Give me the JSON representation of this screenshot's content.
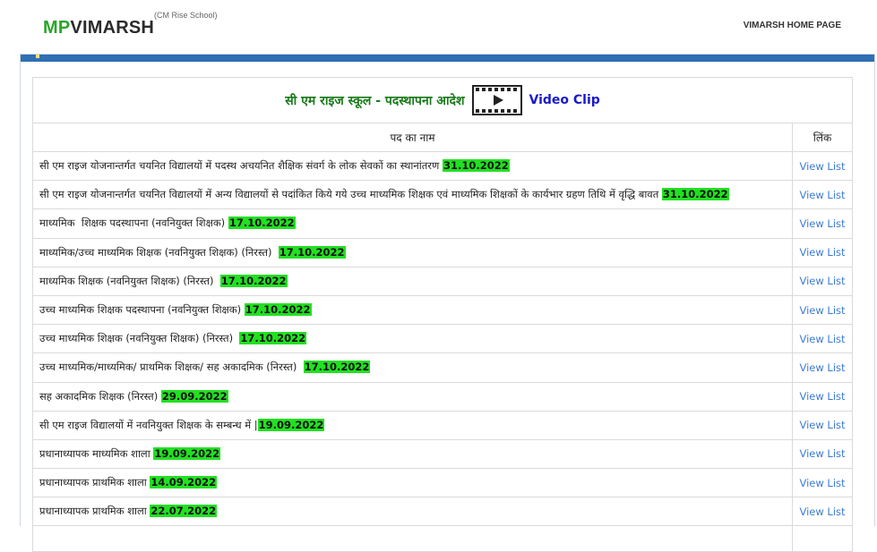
{
  "header": {
    "logo_mp": "MP",
    "logo_rest": "VIMARSH",
    "logo_sub": "(CM Rise School)",
    "home_link": "VIMARSH HOME PAGE"
  },
  "table": {
    "title": "सी एम राइज स्कूल - पदस्थापना आदेश",
    "video_label": "Video Clip",
    "col_name": "पद का नाम",
    "col_link": "लिंक",
    "rows": [
      {
        "text": "सी एम राइज योजनान्तर्गत चयनित विद्यालयों में पदस्थ अचयनित शैक्षिक संवर्ग के लोक सेवकों का स्थानांतरण ",
        "date": "31.10.2022",
        "link": "View List"
      },
      {
        "text": "सी एम राइज योजनान्तर्गत चयनित विद्यालयों में अन्य विद्यालयों से पदांकित किये गये उच्च माध्यमिक शिक्षक एवं माध्यमिक शिक्षकों के कार्यभार ग्रहण तिथि में वृद्धि बावत ",
        "date": "31.10.2022",
        "link": "View List"
      },
      {
        "text": "माध्यमिक  शिक्षक पदस्थापना (नवनियुक्त शिक्षक) ",
        "date": "17.10.2022",
        "link": "View List"
      },
      {
        "text": "माध्यमिक/उच्च माध्यमिक शिक्षक (नवनियुक्त शिक्षक) (निरस्त)  ",
        "date": "17.10.2022",
        "link": "View List"
      },
      {
        "text": "माध्यमिक शिक्षक (नवनियुक्त शिक्षक) (निरस्त)  ",
        "date": "17.10.2022",
        "link": "View List"
      },
      {
        "text": "उच्च माध्यमिक शिक्षक पदस्थापना (नवनियुक्त शिक्षक) ",
        "date": "17.10.2022",
        "link": "View List"
      },
      {
        "text": "उच्च माध्यमिक शिक्षक (नवनियुक्त शिक्षक) (निरस्त)  ",
        "date": "17.10.2022",
        "link": "View List"
      },
      {
        "text": "उच्च माध्यमिक/माध्यमिक/ प्राथमिक शिक्षक/ सह अकादमिक (निरस्त)  ",
        "date": "17.10.2022",
        "link": "View List"
      },
      {
        "text": "सह अकादमिक शिक्षक (निरस्त) ",
        "date": "29.09.2022",
        "link": "View List"
      },
      {
        "text": "सी एम राइज विद्यालयों में नवनियुक्त शिक्षक के सम्बन्ध में |",
        "date": "19.09.2022",
        "link": "View List"
      },
      {
        "text": "प्रधानाध्यापक माध्यमिक शाला ",
        "date": "19.09.2022",
        "link": "View List"
      },
      {
        "text": "प्रधानाध्यापक प्राथमिक शाला ",
        "date": "14.09.2022",
        "link": "View List"
      },
      {
        "text": "प्रधानाध्यापक प्राथमिक शाला ",
        "date": "22.07.2022",
        "link": "View List"
      }
    ]
  },
  "colors": {
    "date_highlight": "#22e022",
    "accent_blue": "#2f6fb5",
    "logo_green": "#2aa52a",
    "title_green": "#1a7a1a",
    "link_blue": "#3b7bd5"
  }
}
